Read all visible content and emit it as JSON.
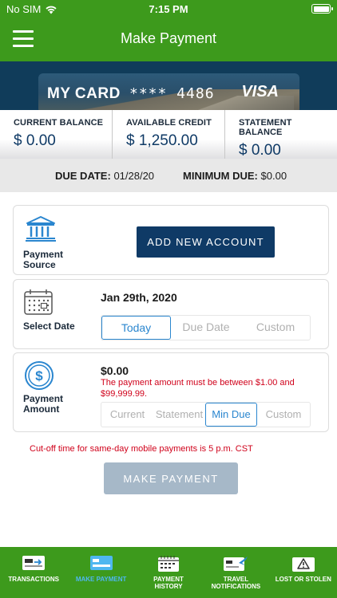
{
  "status_bar": {
    "carrier": "No SIM",
    "time": "7:15 PM"
  },
  "nav": {
    "title": "Make Payment"
  },
  "card": {
    "name": "MY CARD",
    "masked_number": "**** 4486",
    "brand": "VISA"
  },
  "balances": [
    {
      "label": "CURRENT BALANCE",
      "value": "$ 0.00"
    },
    {
      "label": "AVAILABLE CREDIT",
      "value": "$ 1,250.00"
    },
    {
      "label": "STATEMENT BALANCE",
      "value": "$ 0.00"
    }
  ],
  "due": {
    "due_label": "DUE DATE:",
    "due_value": "01/28/20",
    "min_label": "MINIMUM DUE:",
    "min_value": "$0.00"
  },
  "payment_source": {
    "label_line1": "Payment",
    "label_line2": "Source",
    "button": "ADD NEW ACCOUNT"
  },
  "select_date": {
    "label": "Select Date",
    "date": "Jan 29th, 2020",
    "options": [
      "Today",
      "Due Date",
      "Custom"
    ],
    "selected": "Today"
  },
  "payment_amount": {
    "label_line1": "Payment",
    "label_line2": "Amount",
    "amount": "$0.00",
    "error": "The payment amount must be between $1.00 and $99,999.99.",
    "options": [
      "Current",
      "Statement",
      "Min Due",
      "Custom"
    ],
    "selected": "Min Due"
  },
  "cutoff_note": "Cut-off time for same-day mobile payments is 5 p.m. CST",
  "make_payment_button": "MAKE PAYMENT",
  "tabs": [
    {
      "line1": "TRANSACTIONS",
      "line2": "",
      "icon": "transactions-icon"
    },
    {
      "line1": "MAKE PAYMENT",
      "line2": "",
      "icon": "make-payment-icon",
      "active": true
    },
    {
      "line1": "PAYMENT",
      "line2": "HISTORY",
      "icon": "payment-history-icon"
    },
    {
      "line1": "TRAVEL",
      "line2": "NOTIFICATIONS",
      "icon": "travel-notifications-icon"
    },
    {
      "line1": "LOST OR STOLEN",
      "line2": "",
      "icon": "lost-or-stolen-icon"
    }
  ],
  "colors": {
    "brand_green": "#3d9a1c",
    "navy": "#0f3a66",
    "error_red": "#d0021b",
    "active_blue": "#2a86cf"
  }
}
